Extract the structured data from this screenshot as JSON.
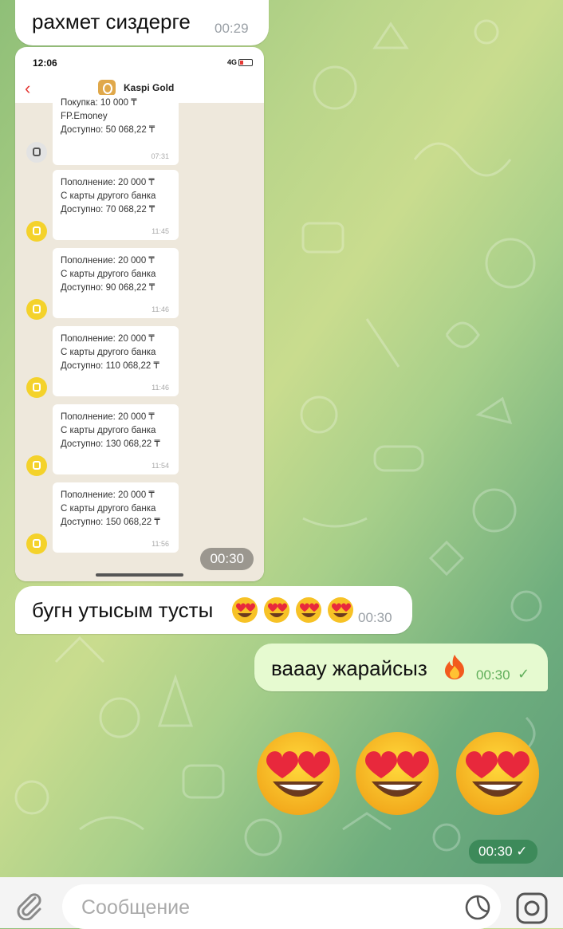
{
  "messages": {
    "m1": {
      "text": "рахмет сиздерге",
      "time": "00:29"
    },
    "m2": {
      "time": "00:30",
      "screenshot": {
        "status_time": "12:06",
        "network": "4G",
        "app_title": "Kaspi Gold",
        "cards": [
          {
            "l1": "Покупка: 10 000 ₸",
            "l2": "FP.Emoney",
            "l3": "Доступно: 50 068,22 ₸",
            "time": "07:31"
          },
          {
            "l1": "Пополнение: 20 000 ₸",
            "l2": "С карты другого банка",
            "l3": "Доступно: 70 068,22 ₸",
            "time": "11:45"
          },
          {
            "l1": "Пополнение: 20 000 ₸",
            "l2": "С карты другого банка",
            "l3": "Доступно: 90 068,22 ₸",
            "time": "11:46"
          },
          {
            "l1": "Пополнение: 20 000 ₸",
            "l2": "С карты другого банка",
            "l3": "Доступно: 110 068,22 ₸",
            "time": "11:46"
          },
          {
            "l1": "Пополнение: 20 000 ₸",
            "l2": "С карты другого банка",
            "l3": "Доступно: 130 068,22 ₸",
            "time": "11:54"
          },
          {
            "l1": "Пополнение: 20 000 ₸",
            "l2": "С карты другого банка",
            "l3": "Доступно: 150 068,22 ₸",
            "time": "11:56"
          }
        ]
      }
    },
    "m3": {
      "text": "бугн утысым тусты",
      "time": "00:30"
    },
    "m4": {
      "text": "вааау жарайсыз",
      "time": "00:30"
    },
    "m5": {
      "time": "00:30"
    }
  },
  "composer": {
    "placeholder": "Сообщение"
  },
  "icons": {
    "attach": "paperclip-icon",
    "sticker": "sticker-icon",
    "camera": "camera-icon",
    "read_check": "check-icon"
  },
  "colors": {
    "outgoing_bubble": "#e6fad0",
    "incoming_bubble": "#ffffff",
    "accent_green": "#5fae5a"
  }
}
